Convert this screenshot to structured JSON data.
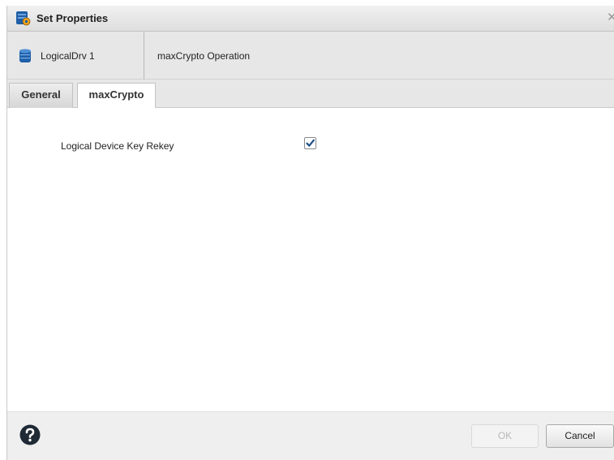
{
  "dialog": {
    "title": "Set Properties",
    "title_icon": "properties-gear-icon",
    "close_icon": "close-icon"
  },
  "device": {
    "name": "LogicalDrv 1",
    "icon": "database-icon",
    "operation": "maxCrypto Operation"
  },
  "tabs": [
    {
      "label": "General",
      "active": false
    },
    {
      "label": "maxCrypto",
      "active": true
    }
  ],
  "form": {
    "field_label": "Logical Device Key Rekey",
    "checked": true
  },
  "footer": {
    "help_icon": "help-icon",
    "ok_label": "OK",
    "ok_enabled": false,
    "cancel_label": "Cancel"
  },
  "colors": {
    "icon_blue": "#1f5fa8",
    "help_dark": "#1f2a36"
  }
}
